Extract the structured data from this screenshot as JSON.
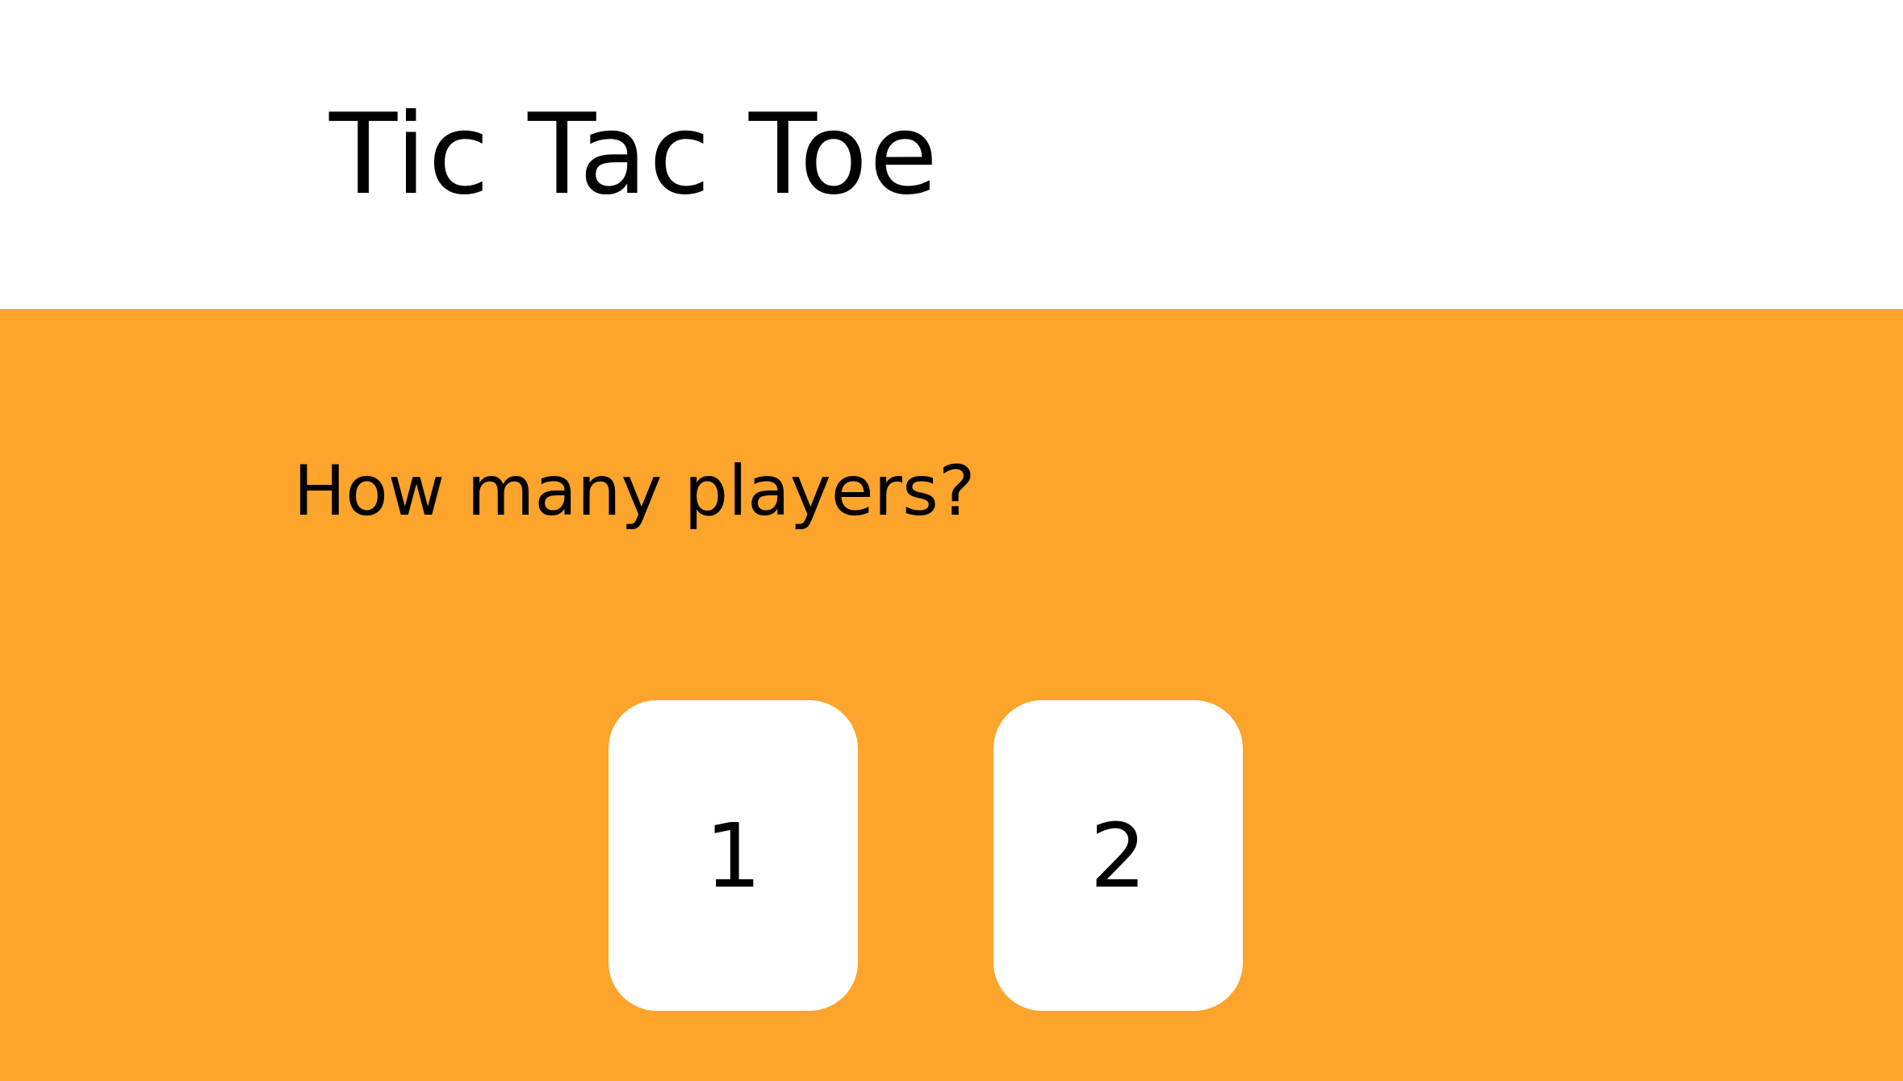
{
  "header": {
    "title": "Tic Tac Toe"
  },
  "main": {
    "question": "How many players?",
    "options": [
      {
        "label": "1"
      },
      {
        "label": "2"
      }
    ]
  },
  "colors": {
    "header_bg": "#ffffff",
    "main_bg": "#fca42b",
    "button_bg": "#ffffff",
    "text": "#000000"
  }
}
